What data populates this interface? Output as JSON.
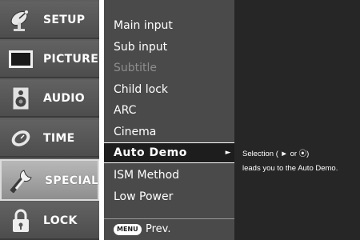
{
  "sidebar": {
    "items": [
      {
        "label": "SETUP",
        "icon": "satellite-dish-icon"
      },
      {
        "label": "PICTURE",
        "icon": "monitor-icon"
      },
      {
        "label": "AUDIO",
        "icon": "speaker-icon"
      },
      {
        "label": "TIME",
        "icon": "clock-icon"
      },
      {
        "label": "SPECIAL",
        "icon": "tools-icon",
        "active": true
      },
      {
        "label": "LOCK",
        "icon": "padlock-icon"
      }
    ]
  },
  "menu": {
    "items": [
      {
        "label": "Main input"
      },
      {
        "label": "Sub input"
      },
      {
        "label": "Subtitle",
        "disabled": true
      },
      {
        "label": "Child lock"
      },
      {
        "label": "ARC"
      },
      {
        "label": "Cinema"
      },
      {
        "label": "Auto Demo",
        "selected": true
      },
      {
        "label": "ISM Method"
      },
      {
        "label": "Low Power"
      }
    ],
    "footer": {
      "button_label": "MENU",
      "action_label": "Prev."
    }
  },
  "help": {
    "line1": "Selection ( ► or ⦿)",
    "line2": "leads you to the Auto Demo."
  },
  "colors": {
    "sidebar_bg": "#5e5e5e",
    "active_bg": "#a5a5a5",
    "menu_bg": "#4a4a4a",
    "selected_bg": "#1d1d1d",
    "info_bg": "#262626",
    "text": "#ffffff",
    "disabled_text": "#8e8e8e"
  }
}
